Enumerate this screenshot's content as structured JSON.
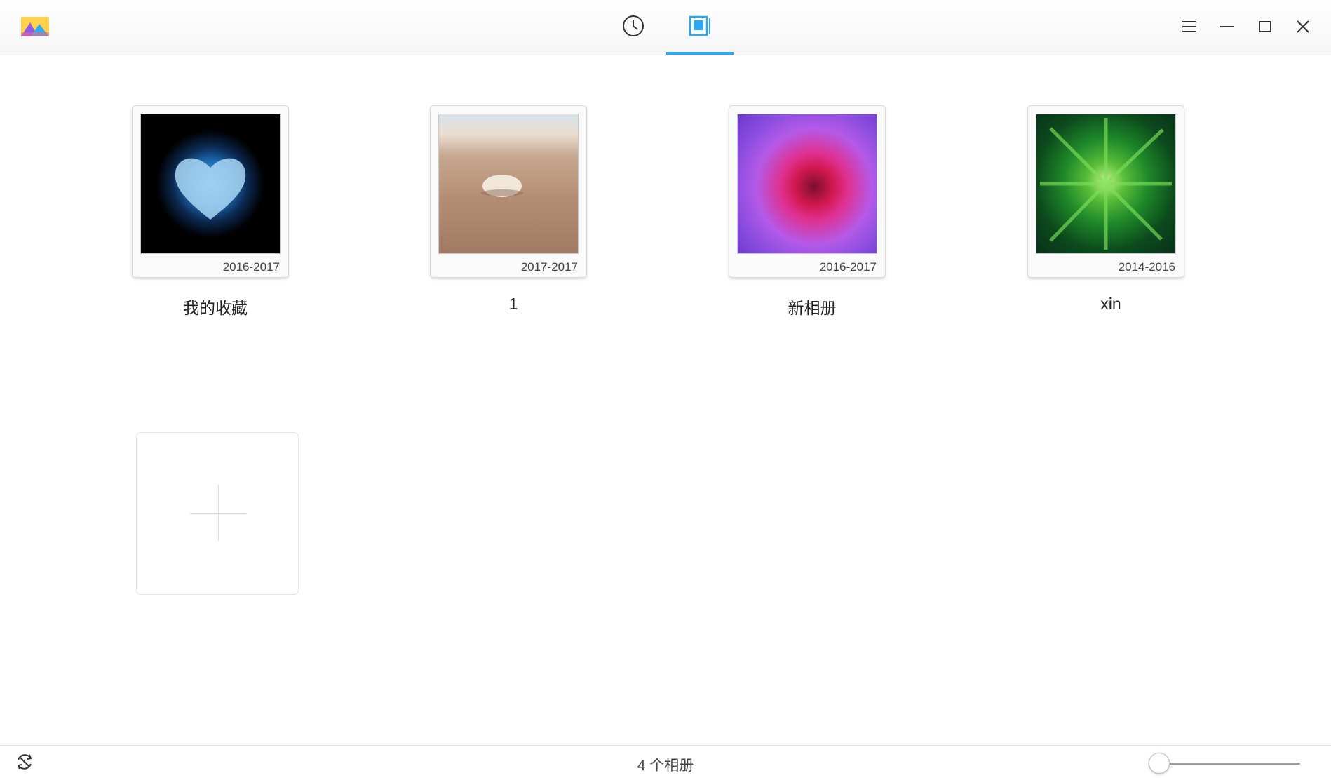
{
  "titlebar": {
    "app_icon": "photo-app-icon",
    "tabs": [
      {
        "name": "timeline",
        "icon": "clock-icon",
        "active": false
      },
      {
        "name": "albums",
        "icon": "album-icon",
        "active": true
      }
    ],
    "window_buttons": [
      "menu-icon",
      "minimize-icon",
      "maximize-icon",
      "close-icon"
    ]
  },
  "albums": [
    {
      "name": "我的收藏",
      "date_range": "2016-2017",
      "thumbnail": "blue heart smoke on black"
    },
    {
      "name": "1",
      "date_range": "2017-2017",
      "thumbnail": "seashell on beach sand"
    },
    {
      "name": "新相册",
      "date_range": "2016-2017",
      "thumbnail": "purple pink swirl"
    },
    {
      "name": "xin",
      "date_range": "2014-2016",
      "thumbnail": "green spiky plant"
    }
  ],
  "status": {
    "album_count": "4 个相册",
    "zoom_level": 0.1
  },
  "colors": {
    "accent": "#2ca7f8"
  }
}
